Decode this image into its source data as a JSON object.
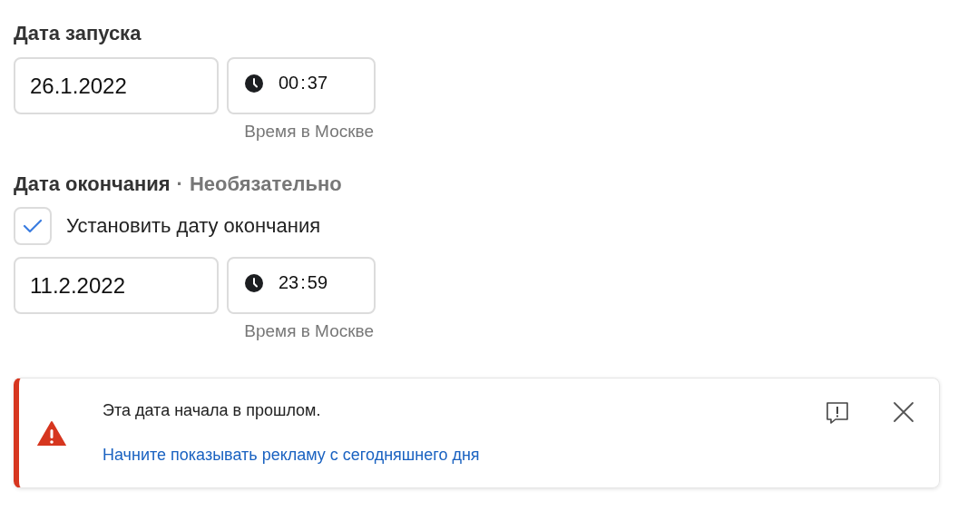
{
  "start": {
    "title": "Дата запуска",
    "date": "26.1.2022",
    "time_hours": "00",
    "time_sep": ":",
    "time_minutes": "37",
    "hint": "Время в Москве"
  },
  "end": {
    "title": "Дата окончания",
    "separator": "·",
    "optional": "Необязательно",
    "checkbox": {
      "label": "Установить дату окончания",
      "checked": true
    },
    "date": "11.2.2022",
    "time_hours": "23",
    "time_sep": ":",
    "time_minutes": "59",
    "hint": "Время в Москве"
  },
  "alert": {
    "message": "Эта дата начала в прошлом.",
    "link": "Начните показывать рекламу с сегодняшнего дня"
  }
}
